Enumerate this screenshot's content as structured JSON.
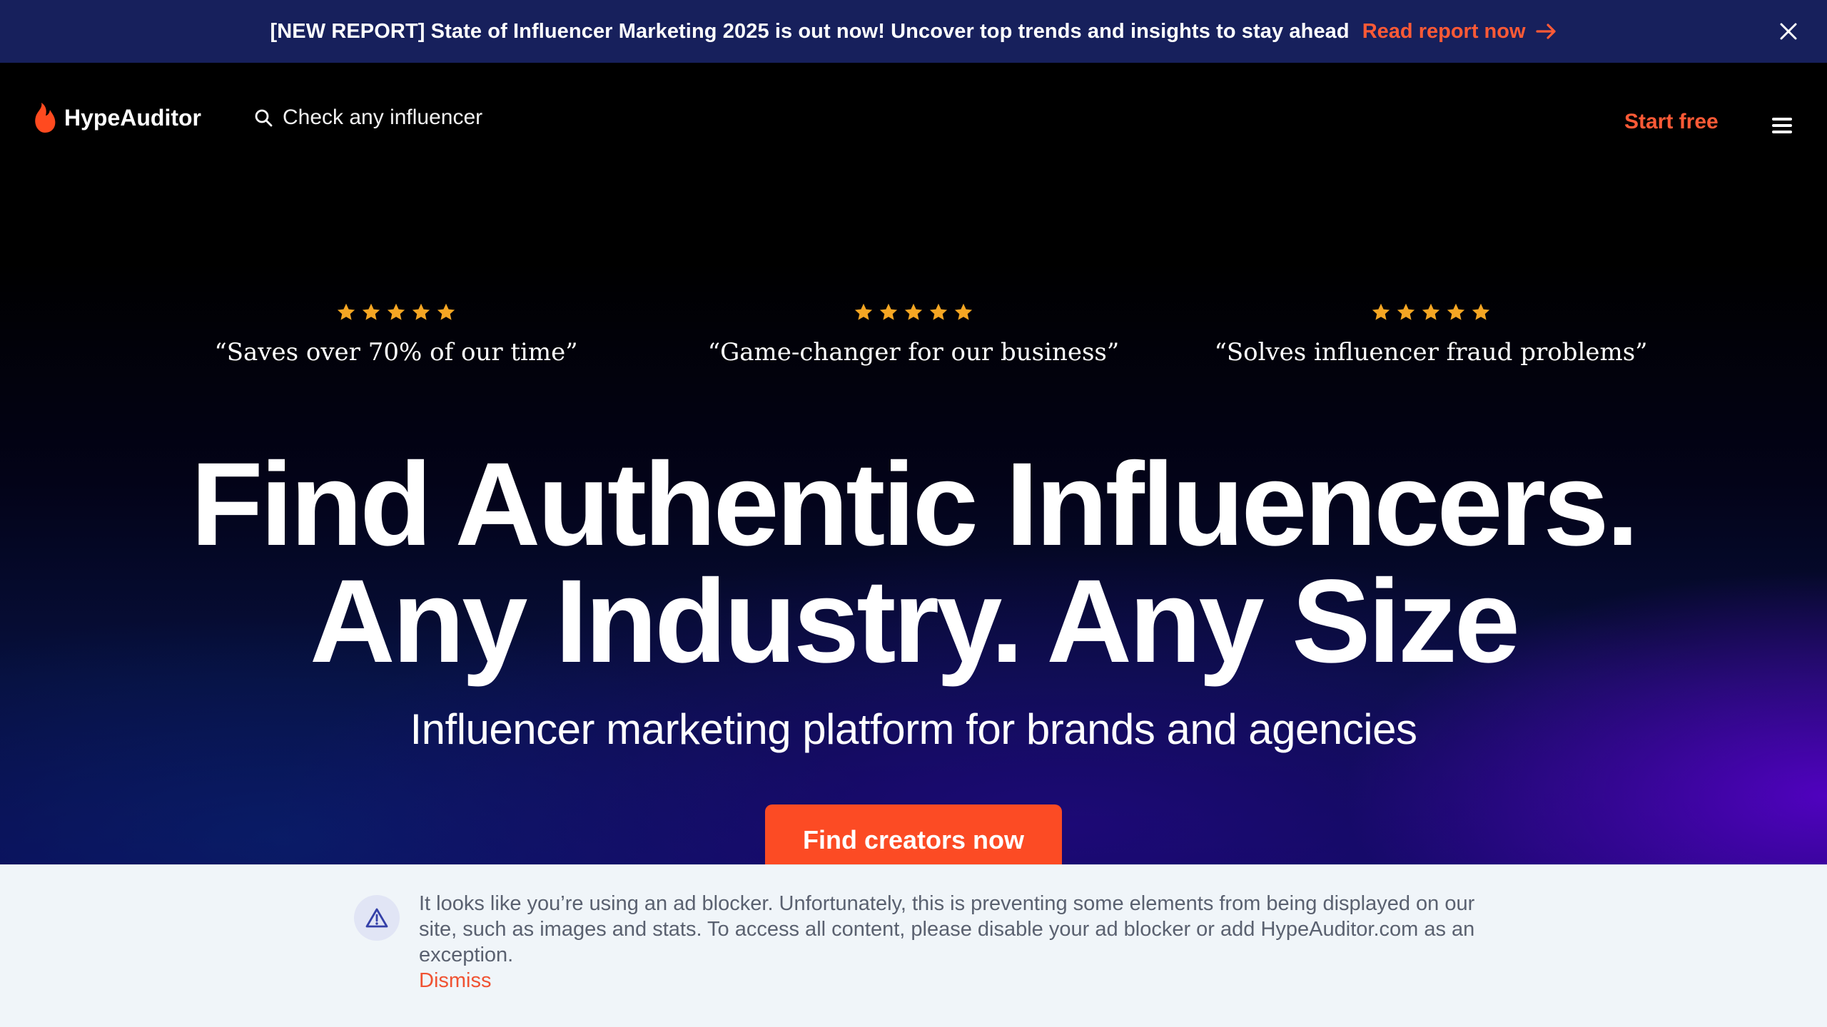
{
  "banner": {
    "text": "[NEW REPORT] State of Influencer Marketing 2025 is out now! Uncover top trends and insights to stay ahead",
    "link_label": "Read report now",
    "link_icon": "arrow-right-icon",
    "close_icon": "close-icon"
  },
  "header": {
    "logo_icon": "flame-icon",
    "logo_text": "HypeAuditor",
    "search_icon": "search-icon",
    "search_label": "Check any influencer",
    "start_free_label": "Start free",
    "menu_icon": "hamburger-menu-icon"
  },
  "hero": {
    "testimonials": [
      {
        "rating": 5,
        "quote": "“Saves over 70% of our time”"
      },
      {
        "rating": 5,
        "quote": "“Game-changer for our business”"
      },
      {
        "rating": 5,
        "quote": "“Solves influencer fraud problems”"
      }
    ],
    "headline_line1": "Find Authentic Influencers.",
    "headline_line2": "Any Industry. Any Size",
    "subheadline": "Influencer marketing platform for brands and agencies",
    "cta_label": "Find creators now"
  },
  "notice": {
    "icon": "warning-icon",
    "text": "It looks like you’re using an ad blocker. Unfortunately, this is preventing some elements from being displayed on our site, such as images and stats. To access all content, please disable your ad blocker or add HypeAuditor.com as an exception.",
    "dismiss_label": "Dismiss"
  },
  "colors": {
    "accent": "#fc4b24",
    "banner_bg": "#17205c",
    "star": "#f5a623",
    "notice_bg": "#f0f5f9"
  }
}
